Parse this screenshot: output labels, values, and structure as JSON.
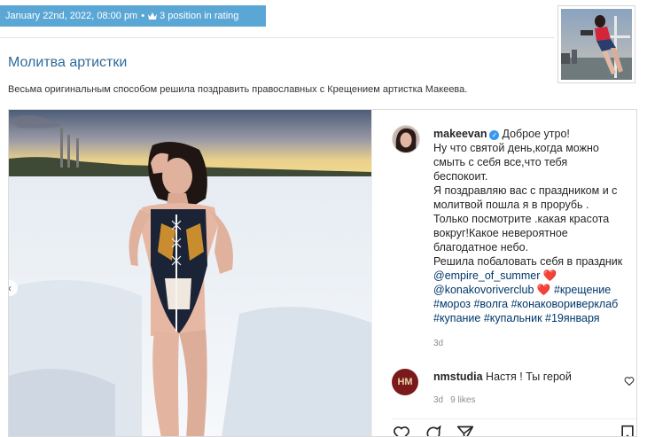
{
  "header": {
    "date": "January 22nd, 2022, 08:00 pm",
    "separator": "•",
    "rating": "3 position in rating"
  },
  "article": {
    "title": "Молитва артистки",
    "lead": "Весьма оригинальным способом решила поздравить православных с Крещением артистка Макеева."
  },
  "post": {
    "username": "makeevan",
    "caption_lines": [
      "Доброе утро!",
      "Ну что святой день,когда можно",
      "смыть с себя все,что тебя",
      "беспокоит.",
      "Я поздравляю вас с праздником и с",
      "молитвой пошла я в прорубь .",
      "Только посмотрите .какая красота",
      "вокруг!Какое невероятное",
      "благодатное небо.",
      "Решила побаловать себя в праздник"
    ],
    "mention1": "@empire_of_summer",
    "mention2": "@konakovoriverclub",
    "heart": "❤️",
    "tags_line1": "#крещение",
    "tags_line2": "#мороз #волга #конаковориверклаб",
    "tags_line3": "#купание #купальник #19января",
    "age": "3d",
    "comment": {
      "username": "nmstudia",
      "avatar_text": "HM",
      "text": "Настя ! Ты герой",
      "age": "3d",
      "likes": "9 likes"
    }
  },
  "colors": {
    "accent": "#5aa7d6",
    "title": "#2f6a9a",
    "link": "#00376b",
    "heart": "#ed4956"
  },
  "icons": [
    "crown-icon",
    "verified-icon",
    "chevron-left-icon",
    "heart-icon",
    "comment-icon",
    "share-icon",
    "bookmark-icon"
  ]
}
